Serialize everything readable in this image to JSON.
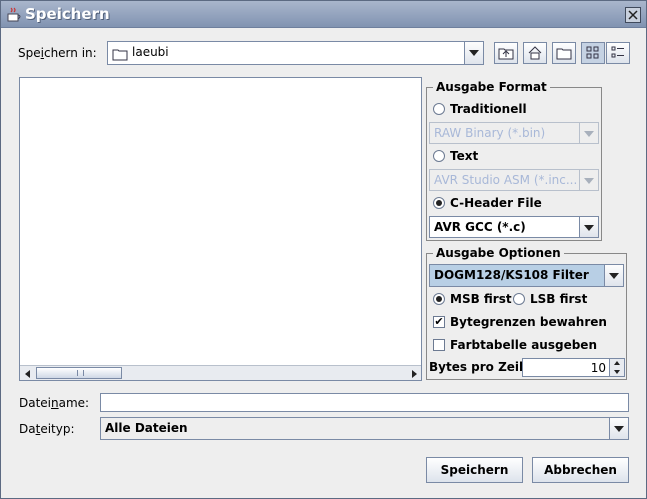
{
  "window": {
    "title": "Speichern"
  },
  "look_in": {
    "label_pre": "Spe",
    "label_mnemonic": "i",
    "label_post": "chern in:",
    "value": "laeubi"
  },
  "toolbar": {
    "icons": [
      "up-folder-icon",
      "home-icon",
      "new-folder-icon",
      "list-view-icon",
      "details-view-icon"
    ]
  },
  "output_format": {
    "legend": "Ausgabe Format",
    "options": [
      {
        "label": "Traditionell",
        "selected": false,
        "combo": "RAW Binary (*.bin)",
        "enabled": false
      },
      {
        "label": "Text",
        "selected": false,
        "combo": "AVR Studio ASM (*.inc...",
        "enabled": false
      },
      {
        "label": "C-Header File",
        "selected": true,
        "combo": "AVR GCC (*.c)",
        "enabled": true
      }
    ]
  },
  "output_options": {
    "legend": "Ausgabe Optionen",
    "filter": "DOGM128/KS108 Filter",
    "msb_first": "MSB first",
    "lsb_first": "LSB first",
    "bit_order_selected": "MSB first",
    "keep_byte_bounds": {
      "label": "Bytegrenzen bewahren",
      "checked": true
    },
    "output_color_table": {
      "label": "Farbtabelle ausgeben",
      "checked": false
    },
    "bytes_per_line_label": "Bytes pro Zeile",
    "bytes_per_line": "10"
  },
  "filename": {
    "label_pre": "Datei",
    "label_mnemonic": "n",
    "label_post": "ame:",
    "value": ""
  },
  "filetype": {
    "label_pre": "Da",
    "label_mnemonic": "t",
    "label_post": "eityp:",
    "value": "Alle Dateien"
  },
  "buttons": {
    "save": "Speichern",
    "cancel": "Abbrechen"
  },
  "colors": {
    "titlebar": "#8ea0bd",
    "selection": "#b8cfe5",
    "disabled_text": "#a8b8d8"
  }
}
